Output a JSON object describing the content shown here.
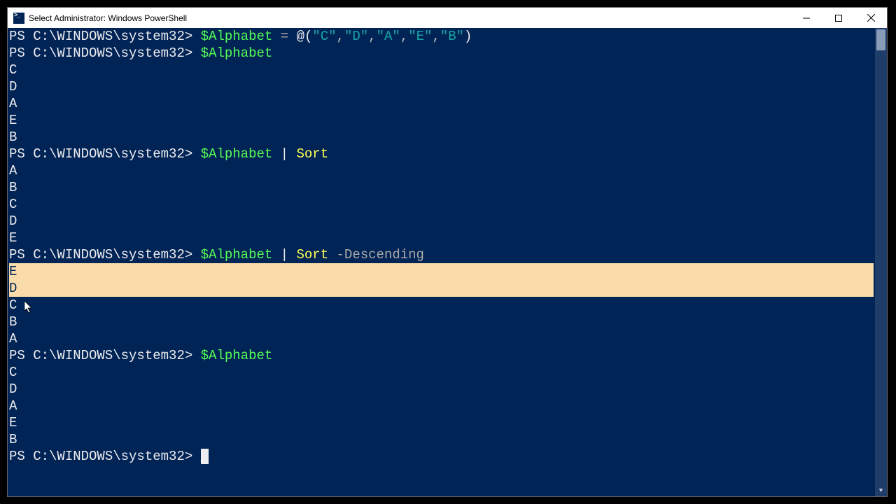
{
  "window": {
    "title": "Select Administrator: Windows PowerShell"
  },
  "prompt": "PS C:\\WINDOWS\\system32> ",
  "tokens": {
    "var": "$Alphabet",
    "assign": " = ",
    "at_open": "@(",
    "close_paren": ")",
    "pipe": " | ",
    "sort": "Sort",
    "desc": " -Descending"
  },
  "array_literal": [
    "\"C\"",
    "\"D\"",
    "\"A\"",
    "\"E\"",
    "\"B\""
  ],
  "output": {
    "original": [
      "C",
      "D",
      "A",
      "E",
      "B"
    ],
    "sorted_asc": [
      "A",
      "B",
      "C",
      "D",
      "E"
    ],
    "sorted_desc": [
      "E",
      "D",
      "C",
      "B",
      "A"
    ]
  },
  "cursor_glyph": "_"
}
